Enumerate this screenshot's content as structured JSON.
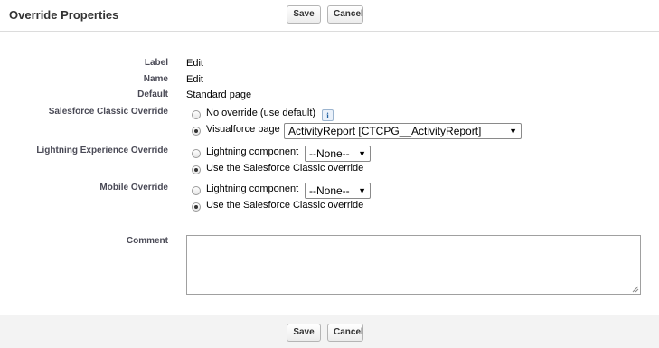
{
  "header": {
    "title": "Override Properties",
    "save_label": "Save",
    "cancel_label": "Cancel"
  },
  "fields": {
    "label": {
      "name": "Label",
      "value": "Edit"
    },
    "name": {
      "name": "Name",
      "value": "Edit"
    },
    "default": {
      "name": "Default",
      "value": "Standard page"
    }
  },
  "classic_override": {
    "label": "Salesforce Classic Override",
    "option_none": "No override (use default)",
    "info_icon": "i",
    "option_vf": "Visualforce page",
    "vf_selected": "ActivityReport [CTCPG__ActivityReport]",
    "selected": "visualforce"
  },
  "lightning_override": {
    "label": "Lightning Experience Override",
    "option_component": "Lightning component",
    "component_selected": "--None--",
    "option_classic": "Use the Salesforce Classic override",
    "selected": "classic"
  },
  "mobile_override": {
    "label": "Mobile Override",
    "option_component": "Lightning component",
    "component_selected": "--None--",
    "option_classic": "Use the Salesforce Classic override",
    "selected": "classic"
  },
  "comment": {
    "label": "Comment",
    "value": ""
  },
  "footer": {
    "save_label": "Save",
    "cancel_label": "Cancel"
  }
}
